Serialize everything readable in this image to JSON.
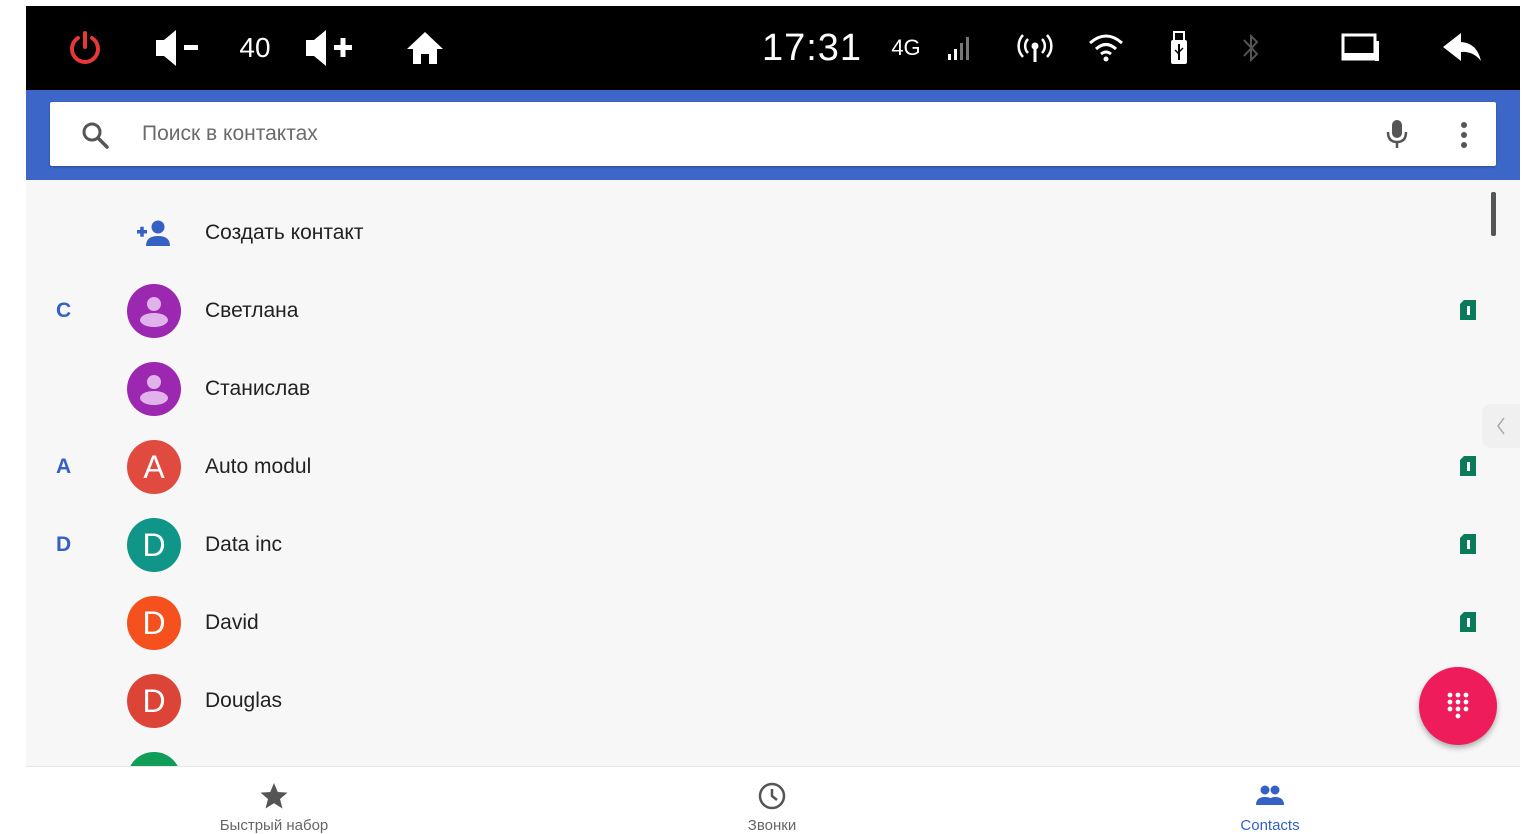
{
  "status_bar": {
    "volume_level": "40",
    "time": "17:31",
    "network": "4G"
  },
  "search": {
    "placeholder": "Поиск в контактах"
  },
  "create_contact": {
    "label": "Создать контакт"
  },
  "contacts": [
    {
      "section": "С",
      "name": "Светлана",
      "avatar_letter": "",
      "avatar_color": "#9c27b0",
      "sim_indicator": true
    },
    {
      "section": "",
      "name": "Станислав",
      "avatar_letter": "",
      "avatar_color": "#9c27b0",
      "sim_indicator": false
    },
    {
      "section": "A",
      "name": "Auto modul",
      "avatar_letter": "A",
      "avatar_color": "#e04a3f",
      "sim_indicator": true
    },
    {
      "section": "D",
      "name": "Data inc",
      "avatar_letter": "D",
      "avatar_color": "#0f9688",
      "sim_indicator": true
    },
    {
      "section": "",
      "name": "David",
      "avatar_letter": "D",
      "avatar_color": "#f4511e",
      "sim_indicator": true
    },
    {
      "section": "",
      "name": "Douglas",
      "avatar_letter": "D",
      "avatar_color": "#db4437",
      "sim_indicator": false
    }
  ],
  "partial_avatar_color": "#0f9d58",
  "bottom_nav": {
    "tabs": [
      {
        "label": "Быстрый набор",
        "icon": "star-icon",
        "active": false
      },
      {
        "label": "Звонки",
        "icon": "clock-icon",
        "active": false
      },
      {
        "label": "Contacts",
        "icon": "people-icon",
        "active": true
      }
    ]
  },
  "colors": {
    "accent": "#3561c4",
    "header": "#3c66c8",
    "fab": "#ef1c5c",
    "sim": "#0a7a5a",
    "power": "#e53935"
  }
}
